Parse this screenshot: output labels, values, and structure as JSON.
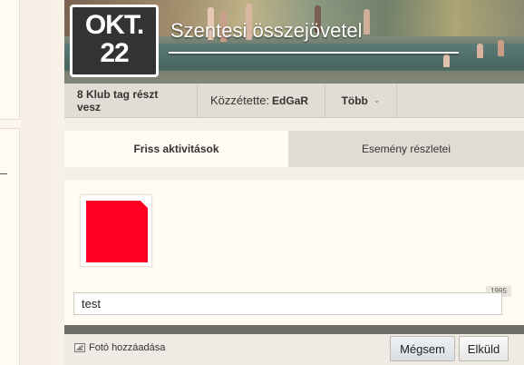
{
  "event": {
    "month": "OKT.",
    "day": "22",
    "title": "Szentesi összejövetel"
  },
  "info_bar": {
    "members": "8 Klub tag részt vesz",
    "posted_by_label": "Közzétette:",
    "poster": "EdGaR",
    "more_label": "Több"
  },
  "tabs": [
    {
      "label": "Friss aktivitások",
      "active": true
    },
    {
      "label": "Esemény részletei",
      "active": false
    }
  ],
  "composer": {
    "char_count": "1995",
    "input_value": "test",
    "avatar_color": "#ff0022"
  },
  "actions": {
    "add_photo": "Fotó hozzáadása",
    "cancel": "Mégsem",
    "send": "Elküld"
  }
}
